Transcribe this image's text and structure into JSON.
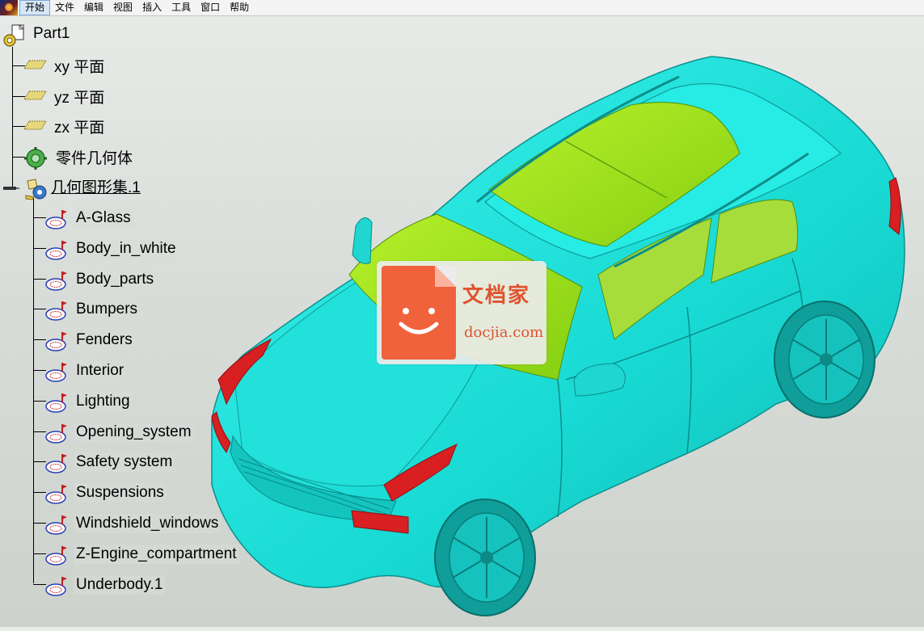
{
  "menu": {
    "items": [
      "开始",
      "文件",
      "编辑",
      "视图",
      "插入",
      "工具",
      "窗口",
      "帮助"
    ],
    "active_index": 0
  },
  "tree": {
    "root": "Part1",
    "planes": [
      "xy 平面",
      "yz 平面",
      "zx 平面"
    ],
    "body": "零件几何体",
    "geom_set": "几何图形集.1",
    "children": [
      "A-Glass",
      "Body_in_white",
      "Body_parts",
      "Bumpers",
      "Fenders",
      "Interior",
      "Lighting",
      "Opening_system",
      "Safety system",
      "Suspensions",
      "Windshield_windows",
      "Z-Engine_compartment",
      "Underbody.1"
    ]
  },
  "viewport": {
    "model_color": "#19e6e0",
    "glass_color": "#9be21a",
    "light_color": "#d81f22"
  },
  "watermark": {
    "cn": "文档家",
    "en": "docjia.com",
    "color": "#f0623b"
  }
}
